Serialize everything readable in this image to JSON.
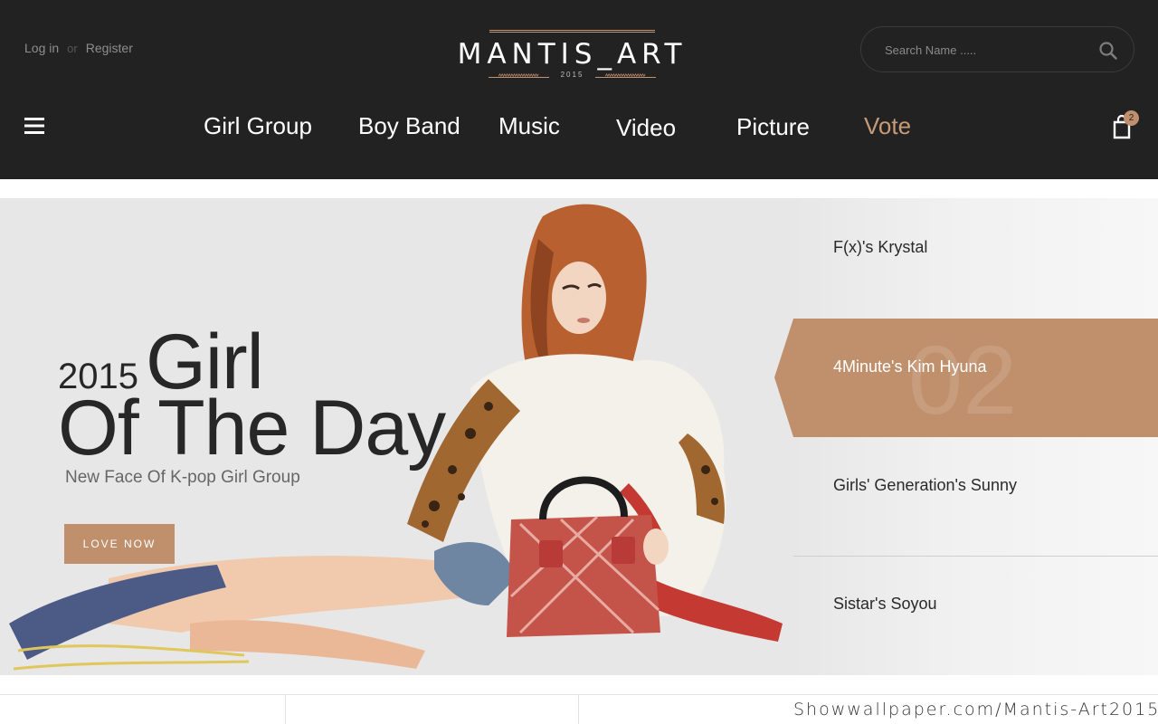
{
  "header": {
    "login_label": "Log in",
    "or_label": "or",
    "register_label": "Register",
    "logo_text": "MANTIS_ART",
    "logo_year": "2015",
    "search_placeholder": "Search Name .....",
    "cart_count": "2"
  },
  "nav": {
    "items": [
      {
        "label": "Girl Group"
      },
      {
        "label": "Boy Band"
      },
      {
        "label": "Music"
      },
      {
        "label": "Video"
      },
      {
        "label": "Picture"
      },
      {
        "label": "Vote"
      }
    ],
    "active": "Vote"
  },
  "hero": {
    "year": "2015",
    "title_word": "Girl",
    "title_line2": "Of The Day",
    "subtitle": "New Face Of K-pop Girl Group",
    "cta_label": "LOVE NOW"
  },
  "list": {
    "items": [
      {
        "label": "F(x)'s Krystal"
      },
      {
        "label": "4Minute's Kim Hyuna",
        "number": "02"
      },
      {
        "label": "Girls' Generation's Sunny"
      },
      {
        "label": "Sistar's Soyou"
      }
    ],
    "active_index": 1
  },
  "watermark": "Showwallpaper.com/Mantis-Art2015",
  "colors": {
    "header_bg": "#222222",
    "accent": "#c0906d",
    "hero_bg": "#e7e7e7"
  },
  "icons": [
    "search-icon",
    "menu-icon",
    "shopping-bag-icon"
  ]
}
